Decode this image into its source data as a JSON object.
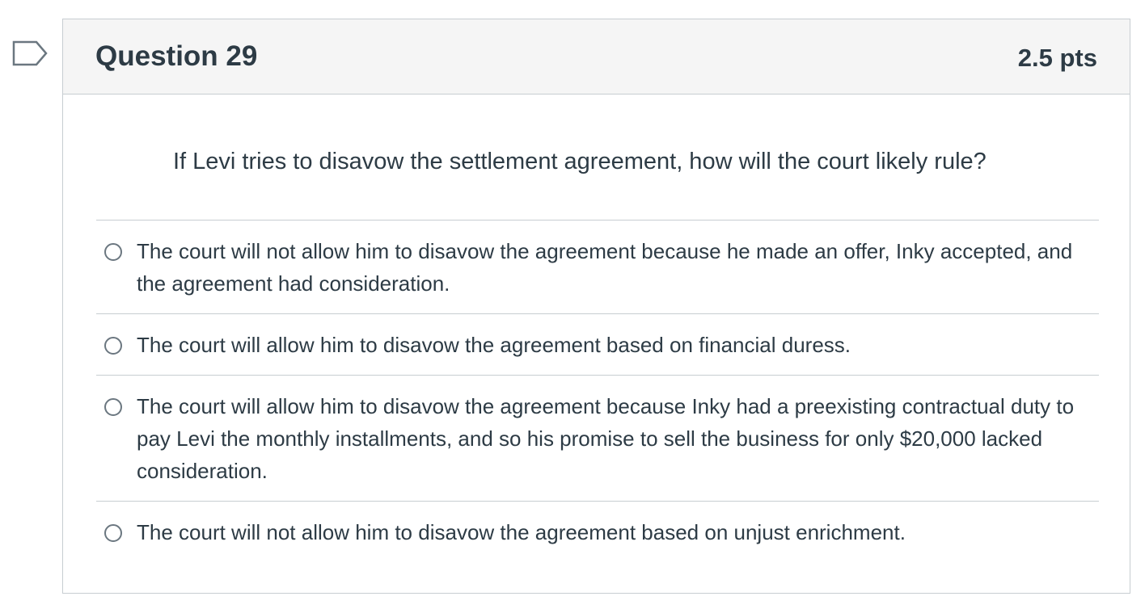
{
  "question": {
    "title": "Question 29",
    "points": "2.5 pts",
    "text": "If Levi tries to disavow the settlement agreement, how will the court likely rule?",
    "flag_icon": "bookmark-flag-icon"
  },
  "answers": [
    {
      "label": "The court will not allow him to disavow the agreement because he made an offer, Inky accepted, and the agreement had consideration.",
      "selected": false
    },
    {
      "label": "The court will allow him to disavow the agreement based on financial duress.",
      "selected": false
    },
    {
      "label": "The court will allow him to disavow the agreement because Inky had a preexisting contractual duty to pay Levi the monthly installments, and so his promise to sell the business for only $20,000 lacked consideration.",
      "selected": false
    },
    {
      "label": "The court will not allow him to disavow the agreement based on unjust enrichment.",
      "selected": false
    }
  ],
  "colors": {
    "text": "#2d3b45",
    "border": "#c7cdd1",
    "header_bg": "#f5f5f5",
    "flag": "#6b7780"
  }
}
